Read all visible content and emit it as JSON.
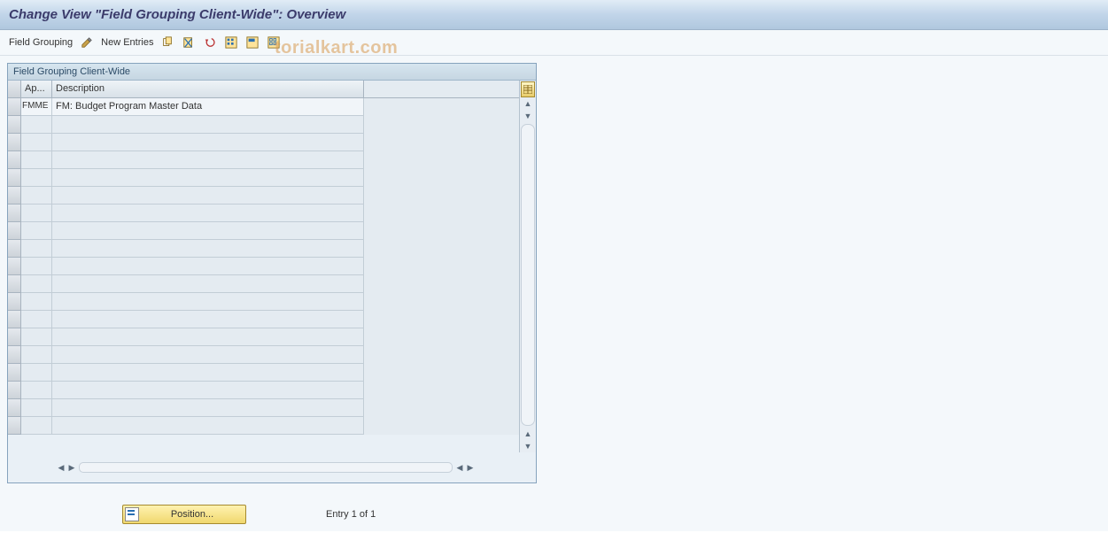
{
  "title": "Change View \"Field Grouping Client-Wide\": Overview",
  "toolbar": {
    "field_grouping_label": "Field Grouping",
    "new_entries_label": "New Entries"
  },
  "watermark_text": "torialkart.com",
  "panel": {
    "title": "Field Grouping Client-Wide",
    "columns": {
      "app": "Ap...",
      "description": "Description"
    },
    "rows": [
      {
        "app": "FMME",
        "description": "FM: Budget Program Master Data"
      }
    ],
    "empty_row_count": 18
  },
  "footer": {
    "position_label": "Position...",
    "entry_text": "Entry 1 of 1"
  },
  "icons": {
    "pencil": "pencil-icon",
    "copy": "copy-icon",
    "delete": "delete-icon",
    "undo": "undo-icon",
    "select_all": "select-all-icon",
    "select_block": "select-block-icon",
    "deselect_all": "deselect-all-icon",
    "table_settings": "table-settings-icon"
  }
}
